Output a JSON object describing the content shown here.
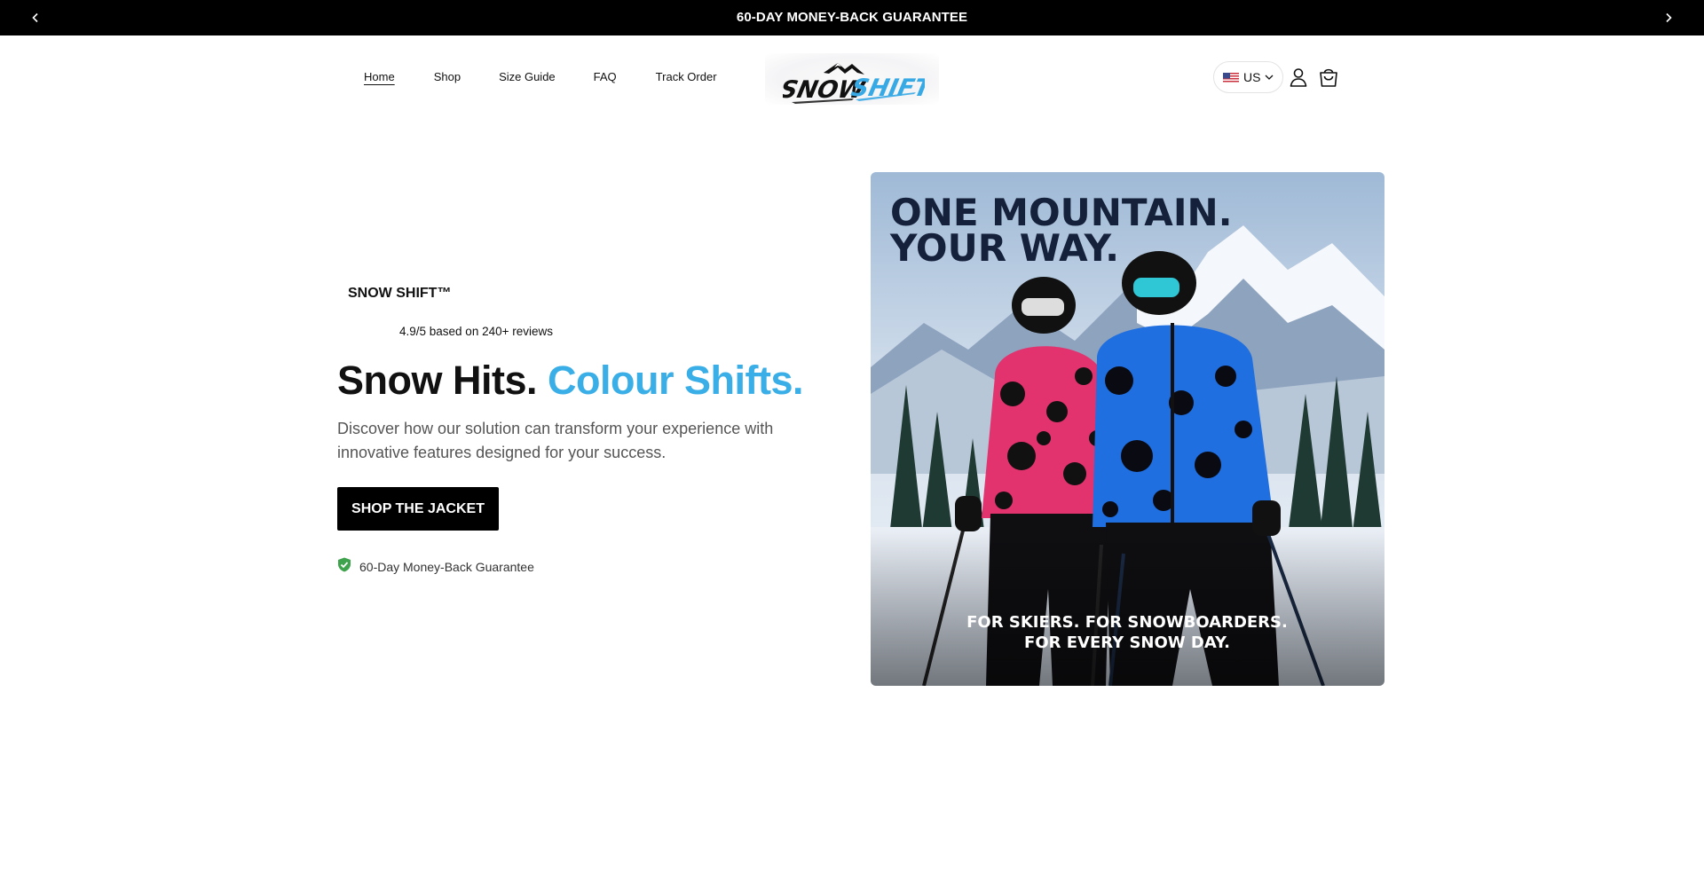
{
  "announcement": {
    "text": "60-DAY MONEY-BACK GUARANTEE",
    "prev_icon": "chevron-left-icon",
    "next_icon": "chevron-right-icon"
  },
  "nav": {
    "items": [
      {
        "label": "Home",
        "active": true
      },
      {
        "label": "Shop",
        "active": false
      },
      {
        "label": "Size Guide",
        "active": false
      },
      {
        "label": "FAQ",
        "active": false
      },
      {
        "label": "Track Order",
        "active": false
      }
    ]
  },
  "logo": {
    "text": "SNOWSHIFT"
  },
  "header_actions": {
    "currency": "US",
    "currency_flag": "us-flag-icon",
    "account_icon": "user-icon",
    "cart_icon": "shopping-bag-icon"
  },
  "hero": {
    "brand": "SNOW SHIFT™",
    "rating": "4.9/5 based on 240+ reviews",
    "title_part1": "Snow Hits.",
    "title_part2": "Colour Shifts.",
    "description": "Discover how our solution can transform your experience with innovative features designed for your success.",
    "cta": "SHOP THE JACKET",
    "guarantee": "60-Day Money-Back Guarantee",
    "guarantee_icon": "shield-check-icon"
  },
  "hero_image": {
    "headline_line1": "ONE MOUNTAIN.",
    "headline_line2": "YOUR WAY.",
    "caption_line1": "FOR SKIERS. FOR SNOWBOARDERS.",
    "caption_line2": "FOR EVERY SNOW DAY."
  },
  "colors": {
    "accent": "#3aaee6",
    "announcement_bg": "#000000",
    "cta_bg": "#000000",
    "guarantee_icon": "#3fa34d"
  }
}
